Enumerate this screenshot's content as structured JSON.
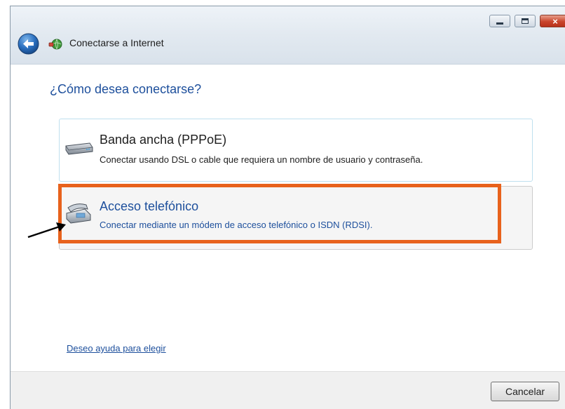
{
  "window": {
    "title": "Conectarse a Internet",
    "close_glyph": "×"
  },
  "heading": "¿Cómo desea conectarse?",
  "options": [
    {
      "title": "Banda ancha (PPPoE)",
      "description": "Conectar usando DSL o cable que requiera un nombre de usuario y contraseña.",
      "icon": "broadband-modem-icon"
    },
    {
      "title": "Acceso telefónico",
      "description": "Conectar mediante un módem de acceso telefónico o ISDN (RDSI).",
      "icon": "dialup-phone-icon",
      "highlighted": true
    }
  ],
  "help_link": "Deseo ayuda para elegir",
  "footer": {
    "cancel_label": "Cancelar"
  },
  "colors": {
    "accent_text": "#1d4f9c",
    "highlight_box": "#e8621c",
    "close_button": "#c9452c"
  }
}
